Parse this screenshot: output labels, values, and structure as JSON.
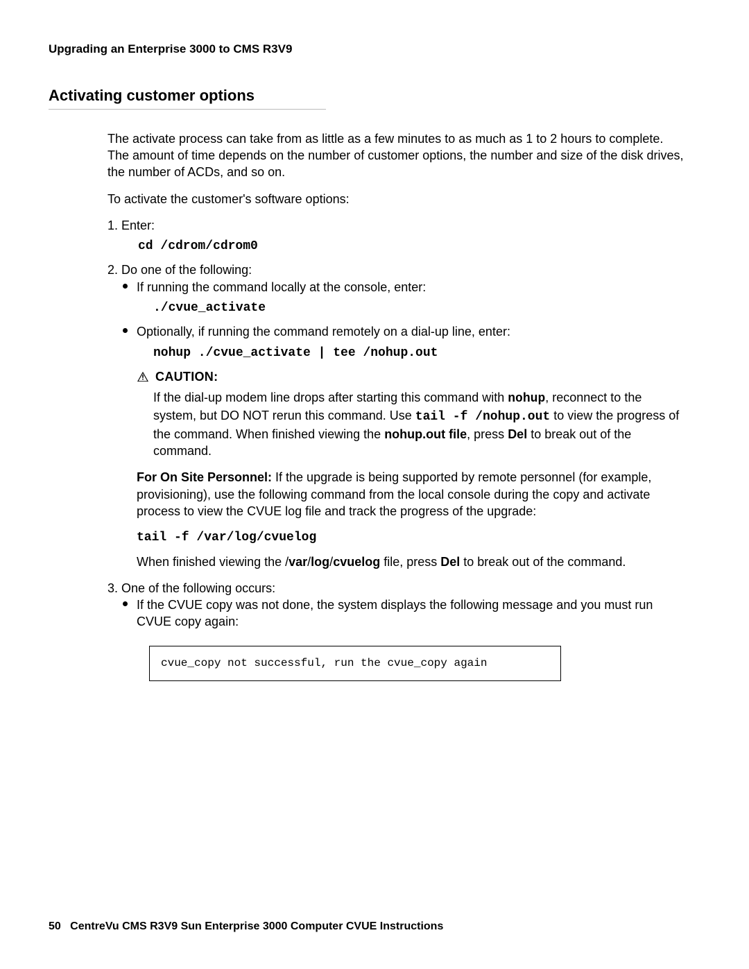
{
  "header": {
    "running": "Upgrading an Enterprise 3000 to CMS R3V9"
  },
  "section": {
    "title": "Activating customer options"
  },
  "paragraphs": {
    "intro": "The activate process can take from as little as a few minutes to as much as 1 to 2 hours to complete. The amount of time depends on the number of customer options, the number and size of the disk drives, the number of ACDs, and so on.",
    "lead_in": "To activate the customer's software options:"
  },
  "steps": {
    "s1": {
      "text": "Enter:",
      "code": "cd /cdrom/cdrom0"
    },
    "s2": {
      "text": "Do one of the following:",
      "bullet_a": "If running the command locally at the console, enter:",
      "code_a": "./cvue_activate",
      "bullet_b": "Optionally, if running the command remotely on a dial-up line, enter:",
      "code_b": "nohup ./cvue_activate | tee /nohup.out",
      "caution_label": "CAUTION:",
      "caution_body_pre": "If the dial-up modem line drops after starting this command with ",
      "caution_body_nohup": "nohup",
      "caution_body_mid": ", reconnect to the system, but DO NOT rerun this command. Use ",
      "caution_body_tail_cmd": "tail -f /nohup.out",
      "caution_body_post": " to view the progress of the command. When finished viewing the ",
      "caution_body_file": "nohup.out file",
      "caution_body_press": ", press ",
      "caution_body_del": "Del",
      "caution_body_end": " to break out of the command.",
      "onsite_label": "For On Site Personnel:",
      "onsite_text": " If the upgrade is being supported by remote personnel (for example, provisioning), use the following command from the local console during the copy and activate process to view the CVUE log file and track the progress of the upgrade:",
      "onsite_code": "tail -f /var/log/cvuelog",
      "onsite_after_pre": "When finished viewing the /",
      "onsite_after_var": "var",
      "onsite_after_sep1": "/",
      "onsite_after_log": "log",
      "onsite_after_sep2": "/",
      "onsite_after_cvuelog": "cvuelog",
      "onsite_after_mid": " file, press ",
      "onsite_after_del": "Del",
      "onsite_after_end": " to break out of the command."
    },
    "s3": {
      "text": "One of the following occurs:",
      "bullet_a": "If the CVUE copy was not done, the system displays the following message and you must run CVUE copy again:",
      "output": "cvue_copy not successful, run the cvue_copy again"
    }
  },
  "footer": {
    "page_number": "50",
    "doc_title": "CentreVu CMS R3V9 Sun Enterprise 3000 Computer CVUE Instructions"
  }
}
